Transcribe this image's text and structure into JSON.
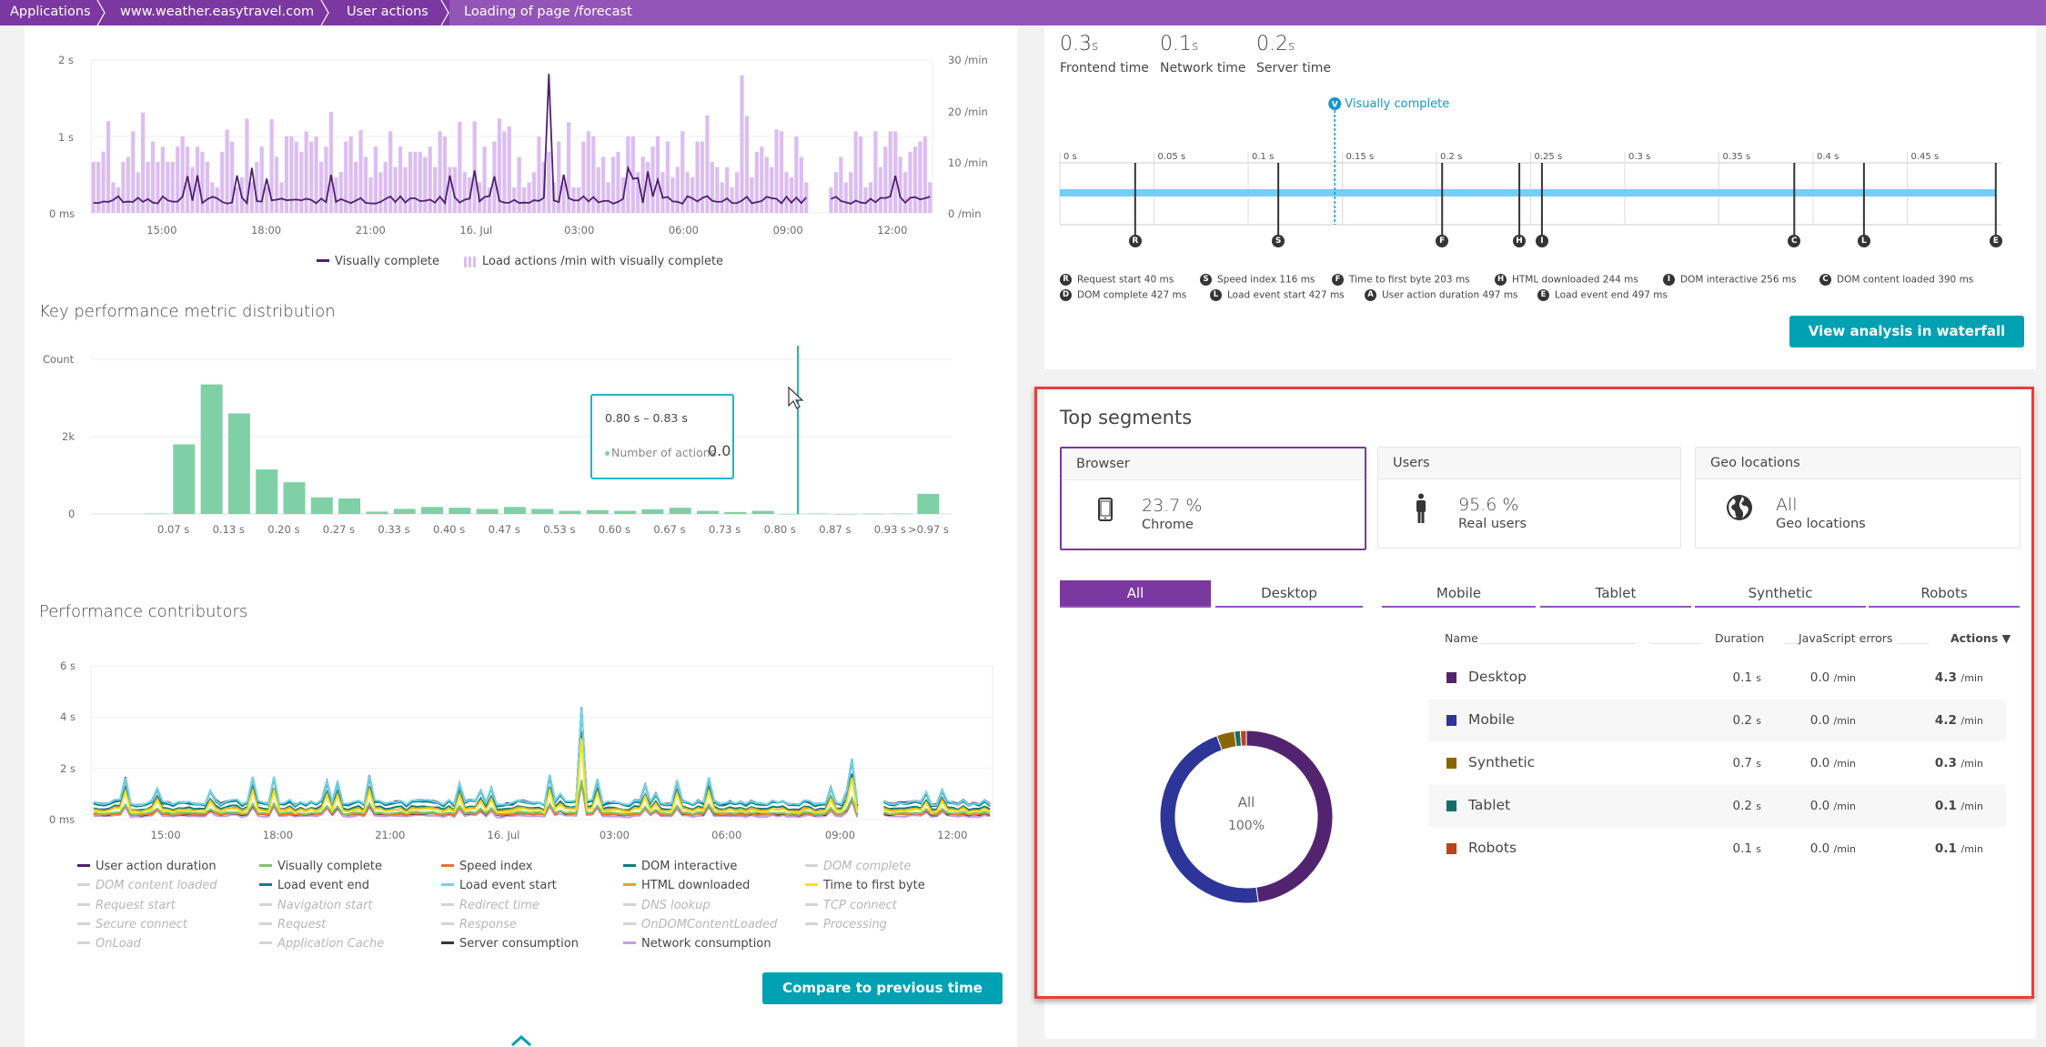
{
  "breadcrumb": [
    "Applications",
    "www.weather.easytravel.com",
    "User actions",
    "Loading of page /forecast"
  ],
  "top_chart": {
    "type": "bar+line",
    "left_axis_ticks": [
      "2 s",
      "1 s",
      "0 ms"
    ],
    "right_axis_ticks": [
      "30 /min",
      "20 /min",
      "10 /min",
      "0 /min"
    ],
    "x_ticks": [
      "15:00",
      "18:00",
      "21:00",
      "16. Jul",
      "03:00",
      "06:00",
      "09:00",
      "12:00"
    ],
    "legend": [
      "Visually complete",
      "Load actions /min with visually complete"
    ],
    "colors": {
      "line": "#4f1f6f",
      "bar": "#dcbef2"
    }
  },
  "kpm": {
    "title": "Key performance metric distribution",
    "y_label": "Count",
    "y_ticks": [
      "2k",
      "0"
    ],
    "x_ticks": [
      "0.07 s",
      "0.13 s",
      "0.20 s",
      "0.27 s",
      "0.33 s",
      "0.40 s",
      "0.47 s",
      "0.53 s",
      "0.60 s",
      "0.67 s",
      "0.73 s",
      "0.80 s",
      "0.87 s",
      "0.93 s",
      ">0.97 s"
    ],
    "tooltip": {
      "range": "0.80 s – 0.83 s",
      "label": "Number of actions",
      "value": "0.0"
    },
    "bar_color": "#7fd0a6",
    "cursor_color": "#1ab7c8"
  },
  "perf": {
    "title": "Performance contributors",
    "y_ticks": [
      "6 s",
      "4 s",
      "2 s",
      "0 ms"
    ],
    "x_ticks": [
      "15:00",
      "18:00",
      "21:00",
      "16. Jul",
      "03:00",
      "06:00",
      "09:00",
      "12:00"
    ],
    "legend": [
      {
        "label": "User action duration",
        "color": "#4f1f6f",
        "on": true
      },
      {
        "label": "Visually complete",
        "color": "#7dc56d",
        "on": true
      },
      {
        "label": "Speed index",
        "color": "#f0702d",
        "on": true
      },
      {
        "label": "DOM interactive",
        "color": "#0d7a7f",
        "on": true
      },
      {
        "label": "DOM complete",
        "color": "",
        "on": false
      },
      {
        "label": "DOM content loaded",
        "color": "",
        "on": false
      },
      {
        "label": "Load event end",
        "color": "#137c8a",
        "on": true
      },
      {
        "label": "Load event start",
        "color": "#6fd7e4",
        "on": true
      },
      {
        "label": "HTML downloaded",
        "color": "#e3a521",
        "on": true
      },
      {
        "label": "Time to first byte",
        "color": "#f4e229",
        "on": true
      },
      {
        "label": "Request start",
        "color": "",
        "on": false
      },
      {
        "label": "Navigation start",
        "color": "",
        "on": false
      },
      {
        "label": "Redirect time",
        "color": "",
        "on": false
      },
      {
        "label": "DNS lookup",
        "color": "",
        "on": false
      },
      {
        "label": "TCP connect",
        "color": "",
        "on": false
      },
      {
        "label": "Secure connect",
        "color": "",
        "on": false
      },
      {
        "label": "Request",
        "color": "",
        "on": false
      },
      {
        "label": "Response",
        "color": "",
        "on": false
      },
      {
        "label": "OnDOMContentLoaded",
        "color": "",
        "on": false
      },
      {
        "label": "Processing",
        "color": "",
        "on": false
      },
      {
        "label": "OnLoad",
        "color": "",
        "on": false
      },
      {
        "label": "Application Cache",
        "color": "",
        "on": false
      },
      {
        "label": "Server consumption",
        "color": "#353535",
        "on": true
      },
      {
        "label": "Network consumption",
        "color": "#c79ae8",
        "on": true
      }
    ],
    "compare_button": "Compare to previous time frame"
  },
  "timings": {
    "kpis": [
      {
        "value": "0.3",
        "unit": "s",
        "label": "Frontend time"
      },
      {
        "value": "0.1",
        "unit": "s",
        "label": "Network time"
      },
      {
        "value": "0.2",
        "unit": "s",
        "label": "Server time"
      }
    ],
    "visually_complete_label": "Visually complete",
    "visually_complete_ms": 146,
    "axis_ticks": [
      "0 s",
      "0.05 s",
      "0.1 s",
      "0.15 s",
      "0.2 s",
      "0.25 s",
      "0.3 s",
      "0.35 s",
      "0.4 s",
      "0.45 s"
    ],
    "axis_max_ms": 500,
    "markers": [
      {
        "letter": "R",
        "ms": 40
      },
      {
        "letter": "S",
        "ms": 116
      },
      {
        "letter": "F",
        "ms": 203
      },
      {
        "letter": "H",
        "ms": 244
      },
      {
        "letter": "I",
        "ms": 256
      },
      {
        "letter": "C",
        "ms": 390
      },
      {
        "letter": "L",
        "ms": 427
      },
      {
        "letter": "E",
        "ms": 497
      }
    ],
    "legend": [
      {
        "letter": "R",
        "text": "Request start 40 ms"
      },
      {
        "letter": "S",
        "text": "Speed index 116 ms"
      },
      {
        "letter": "F",
        "text": "Time to first byte 203 ms"
      },
      {
        "letter": "H",
        "text": "HTML downloaded 244 ms"
      },
      {
        "letter": "I",
        "text": "DOM interactive 256 ms"
      },
      {
        "letter": "C",
        "text": "DOM content loaded 390 ms"
      },
      {
        "letter": "D",
        "text": "DOM complete 427 ms"
      },
      {
        "letter": "L",
        "text": "Load event start 427 ms"
      },
      {
        "letter": "A",
        "text": "User action duration 497 ms"
      },
      {
        "letter": "E",
        "text": "Load event end 497 ms"
      }
    ],
    "waterfall_button": "View analysis in waterfall chart"
  },
  "segments": {
    "title": "Top segments",
    "cards": [
      {
        "header": "Browser",
        "value": "23.7 %",
        "sub": "Chrome",
        "icon": "mobile-phone-icon",
        "selected": true
      },
      {
        "header": "Users",
        "value": "95.6 %",
        "sub": "Real users",
        "icon": "person-icon",
        "selected": false
      },
      {
        "header": "Geo locations",
        "value": "All",
        "sub": "Geo locations",
        "icon": "globe-icon",
        "selected": false
      }
    ],
    "tabs": [
      "All",
      "Desktop",
      "Mobile",
      "Tablet",
      "Synthetic",
      "Robots"
    ],
    "active_tab": "All",
    "donut": {
      "center_label": "All",
      "center_value": "100%"
    },
    "columns": [
      "Name",
      "Duration",
      "JavaScript errors",
      "Actions ▼"
    ],
    "rows": [
      {
        "name": "Desktop",
        "color": "#52246f",
        "duration": "0.1",
        "duration_unit": "s",
        "js_errors": "0.0",
        "js_unit": "/min",
        "actions": "4.3",
        "actions_unit": "/min",
        "actions_value": 4.3
      },
      {
        "name": "Mobile",
        "color": "#2e3599",
        "duration": "0.2",
        "duration_unit": "s",
        "js_errors": "0.0",
        "js_unit": "/min",
        "actions": "4.2",
        "actions_unit": "/min",
        "actions_value": 4.2
      },
      {
        "name": "Synthetic",
        "color": "#8b6600",
        "duration": "0.7",
        "duration_unit": "s",
        "js_errors": "0.0",
        "js_unit": "/min",
        "actions": "0.3",
        "actions_unit": "/min",
        "actions_value": 0.3
      },
      {
        "name": "Tablet",
        "color": "#136f6a",
        "duration": "0.2",
        "duration_unit": "s",
        "js_errors": "0.0",
        "js_unit": "/min",
        "actions": "0.1",
        "actions_unit": "/min",
        "actions_value": 0.1
      },
      {
        "name": "Robots",
        "color": "#b7441d",
        "duration": "0.1",
        "duration_unit": "s",
        "js_errors": "0.0",
        "js_unit": "/min",
        "actions": "0.1",
        "actions_unit": "/min",
        "actions_value": 0.1
      }
    ]
  }
}
